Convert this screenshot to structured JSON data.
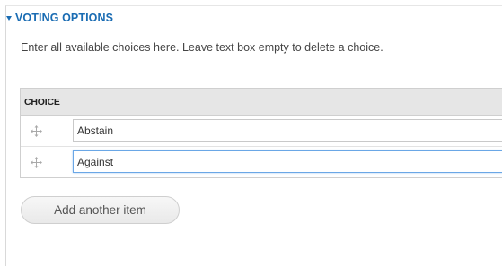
{
  "fieldset": {
    "legend": "VOTING OPTIONS",
    "description": "Enter all available choices here. Leave text box empty to delete a choice."
  },
  "table": {
    "header": "CHOICE",
    "rows": [
      {
        "value": "Abstain",
        "handle_icon": "drag-handle-icon"
      },
      {
        "value": "Against",
        "handle_icon": "drag-handle-icon"
      }
    ]
  },
  "add_button_label": "Add another item",
  "colors": {
    "legend": "#1a6cb3",
    "header_bg": "#e6e6e6",
    "focus_border": "#6aa7e6"
  }
}
